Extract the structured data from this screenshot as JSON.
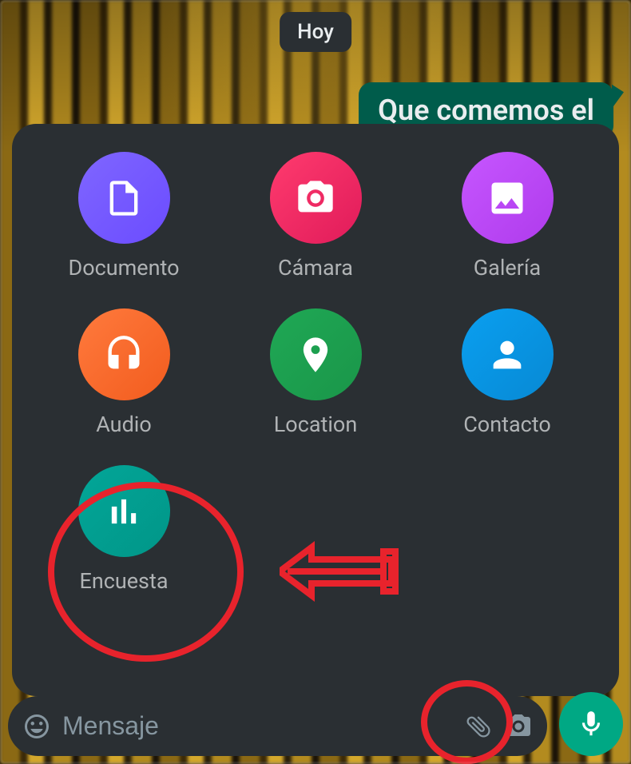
{
  "date_badge": "Hoy",
  "message_preview": "Que comemos el",
  "attachment_menu": {
    "document": "Documento",
    "camera": "Cámara",
    "gallery": "Galería",
    "audio": "Audio",
    "location": "Location",
    "contact": "Contacto",
    "poll": "Encuesta"
  },
  "message_bar": {
    "placeholder": "Mensaje"
  },
  "annotation_highlights": {
    "poll_circled": true,
    "attach_circled": true,
    "arrow_to_poll": true
  },
  "colors": {
    "annotation_red": "#e8232c",
    "bubble_green": "#005c4b",
    "mic_green": "#00a884"
  }
}
